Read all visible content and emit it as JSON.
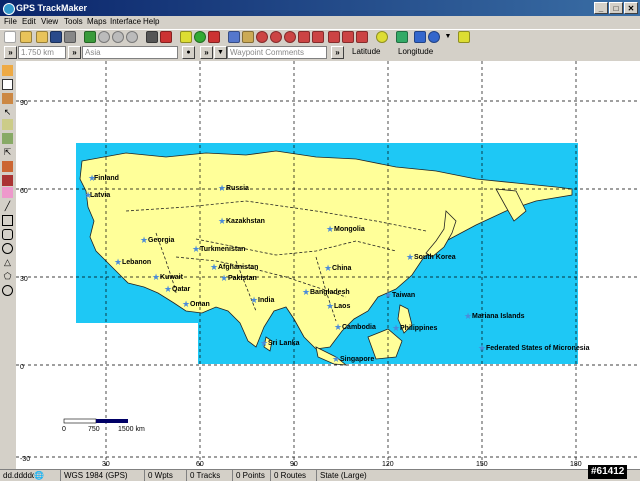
{
  "window": {
    "title": "GPS TrackMaker"
  },
  "menu": [
    "File",
    "Edit",
    "View",
    "Tools",
    "Maps",
    "Interface",
    "Help"
  ],
  "toolbar2": {
    "scale_value": "1.750 km",
    "region": "Asia",
    "waypoint_placeholder": "Waypoint Comments",
    "latitude_label": "Latitude",
    "longitude_label": "Longitude"
  },
  "map": {
    "lat_labels": [
      "90",
      "60",
      "30",
      "0",
      "-30"
    ],
    "lon_labels": [
      "30",
      "60",
      "90",
      "120",
      "150",
      "180"
    ],
    "countries": [
      "Finland",
      "Latvia",
      "Russia",
      "Kazakhstan",
      "Mongolia",
      "Georgia",
      "Turkmenistan",
      "Lebanon",
      "Kuwait",
      "Qatar",
      "Oman",
      "Afghanistan",
      "Pakistan",
      "India",
      "China",
      "South Korea",
      "Bangladesh",
      "Taiwan",
      "Laos",
      "Cambodia",
      "Philippines",
      "Sri Lanka",
      "Singapore",
      "Mariana Islands",
      "Federated States of Micronesia"
    ],
    "scale_bar": [
      "0",
      "750",
      "1500 km"
    ],
    "colors": {
      "sea": "#1ec8f5",
      "land": "#ffff99",
      "border": "#111111"
    }
  },
  "status": {
    "coord_format": "dd.ddddd",
    "datum": "WGS 1984 (GPS)",
    "waypoints": "0 Wpts",
    "tracks": "0 Tracks",
    "points": "0 Points",
    "routes": "0 Routes",
    "map_state": "State (Large)"
  },
  "watermark": "#61412"
}
